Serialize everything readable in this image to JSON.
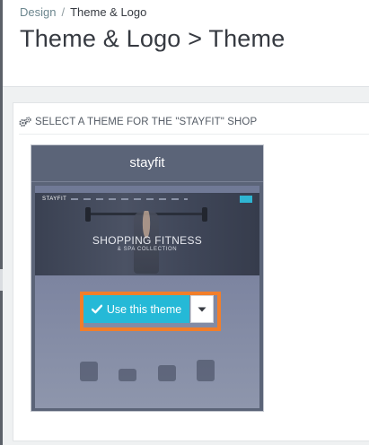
{
  "breadcrumb": {
    "parent": "Design",
    "separator": "/",
    "current": "Theme & Logo"
  },
  "page_title": "Theme & Logo > Theme",
  "panel": {
    "heading": "SELECT A THEME FOR THE \"STAYFIT\" SHOP"
  },
  "theme": {
    "name": "stayfit",
    "preview": {
      "logo_text": "STAYFIT",
      "hero_title": "SHOPPING FITNESS",
      "hero_subtitle": "& SPA COLLECTION"
    },
    "use_button_label": "Use this theme"
  },
  "icons": {
    "cogs": "cogs-icon",
    "check": "check-icon",
    "caret": "caret-down-icon"
  },
  "colors": {
    "primary_button": "#25b9d7",
    "highlight": "#f27e2a",
    "card_background": "#5b6478",
    "page_background": "#eff1f2"
  }
}
